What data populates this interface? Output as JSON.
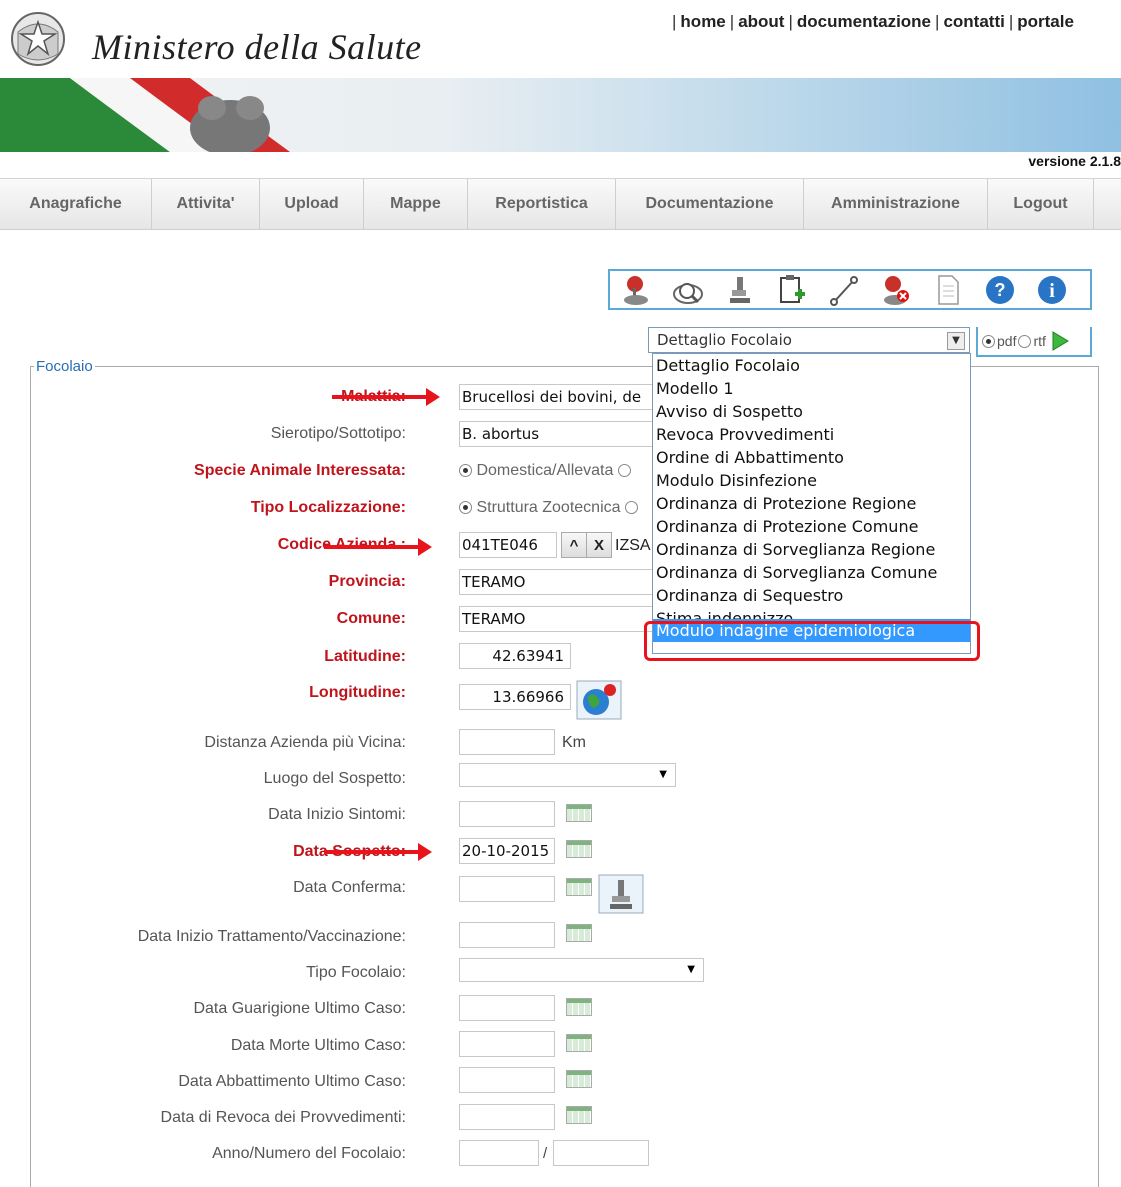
{
  "header": {
    "links": [
      "home",
      "about",
      "documentazione",
      "contatti",
      "portale"
    ],
    "ministry_name": "Ministero della Salute",
    "version": "versione 2.1.8"
  },
  "nav": {
    "items": [
      "Anagrafiche",
      "Attivita'",
      "Upload",
      "Mappe",
      "Reportistica",
      "Documentazione",
      "Amministrazione",
      "Logout"
    ]
  },
  "toolbar": {
    "icons": [
      "map-pin-icon",
      "search-icon",
      "microscope-icon",
      "add-document-icon",
      "link-icon",
      "delete-pin-icon",
      "document-icon",
      "help-icon",
      "info-icon"
    ]
  },
  "report": {
    "selected": "Dettaglio Focolaio",
    "format_pdf": "pdf",
    "format_rtf": "rtf",
    "options": [
      "Dettaglio Focolaio",
      "Modello 1",
      "Avviso di Sospetto",
      "Revoca Provvedimenti",
      "Ordine di Abbattimento",
      "Modulo Disinfezione",
      "Ordinanza di Protezione Regione",
      "Ordinanza di Protezione Comune",
      "Ordinanza di Sorveglianza Regione",
      "Ordinanza di Sorveglianza Comune",
      "Ordinanza di Sequestro",
      "Stima indennizzo",
      "Modulo indagine epidemiologica"
    ],
    "highlighted": "Modulo indagine epidemiologica"
  },
  "form": {
    "legend": "Focolaio",
    "malattia_label": "Malattia:",
    "malattia_value": "Brucellosi dei bovini, de",
    "sierotipo_label": "Sierotipo/Sottotipo:",
    "sierotipo_value": "B. abortus",
    "specie_label": "Specie Animale Interessata:",
    "specie_option": "Domestica/Allevata",
    "tipo_loc_label": "Tipo Localizzazione:",
    "tipo_loc_option": "Struttura Zootecnica",
    "codice_label": "Codice Azienda :",
    "codice_value": "041TE046",
    "codice_btn_up": "^",
    "codice_btn_x": "X",
    "codice_extra": "IZSA",
    "provincia_label": "Provincia:",
    "provincia_value": "TERAMO",
    "comune_label": "Comune:",
    "comune_value": "TERAMO",
    "latitudine_label": "Latitudine:",
    "latitudine_value": "42.63941",
    "longitudine_label": "Longitudine:",
    "longitudine_value": "13.66966",
    "distanza_label": "Distanza Azienda più Vicina:",
    "distanza_unit": "Km",
    "luogo_label": "Luogo del Sospetto:",
    "data_sintomi_label": "Data Inizio Sintomi:",
    "data_sospetto_label": "Data Sospetto:",
    "data_sospetto_value": "20-10-2015",
    "data_conferma_label": "Data Conferma:",
    "data_trattamento_label": "Data Inizio Trattamento/Vaccinazione:",
    "tipo_focolaio_label": "Tipo Focolaio:",
    "data_guarigione_label": "Data Guarigione Ultimo Caso:",
    "data_morte_label": "Data Morte Ultimo Caso:",
    "data_abbattimento_label": "Data Abbattimento Ultimo Caso:",
    "data_revoca_label": "Data di Revoca dei Provvedimenti:",
    "anno_numero_label": "Anno/Numero del Focolaio:",
    "anno_sep": "/"
  }
}
